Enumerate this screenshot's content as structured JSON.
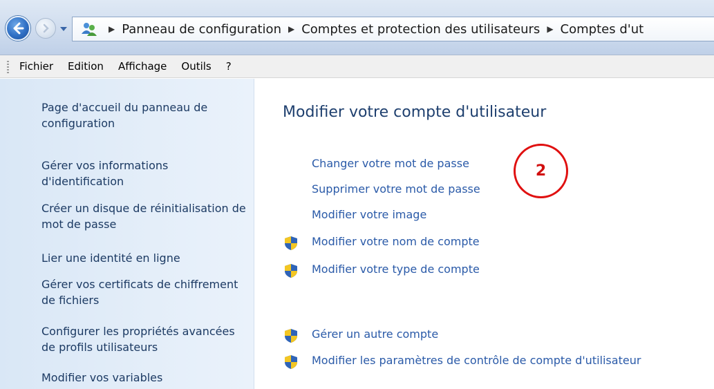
{
  "address_bar": {
    "breadcrumbs": [
      "Panneau de configuration",
      "Comptes et protection des utilisateurs",
      "Comptes d'ut"
    ]
  },
  "menu": [
    "Fichier",
    "Edition",
    "Affichage",
    "Outils",
    "?"
  ],
  "sidebar": {
    "items": [
      "Page d'accueil du panneau de configuration",
      "Gérer vos informations d'identification",
      "Créer un disque de réinitialisation de mot de passe",
      "Lier une identité en ligne",
      "Gérer vos certificats de chiffrement de fichiers",
      "Configurer les propriétés avancées de profils utilisateurs",
      "Modifier vos variables"
    ]
  },
  "main": {
    "title": "Modifier votre compte d'utilisateur",
    "actions": [
      "Changer votre mot de passe",
      "Supprimer votre mot de passe",
      "Modifier votre image",
      "Modifier votre nom de compte",
      "Modifier votre type de compte",
      "Gérer un autre compte",
      "Modifier les paramètres de contrôle de compte d'utilisateur"
    ]
  },
  "annotation": {
    "label": "2",
    "color": "#e01010"
  },
  "colors": {
    "link": "#2a5aa8",
    "title": "#1e3f6e",
    "sidebar_bg": "#dde9f7"
  }
}
